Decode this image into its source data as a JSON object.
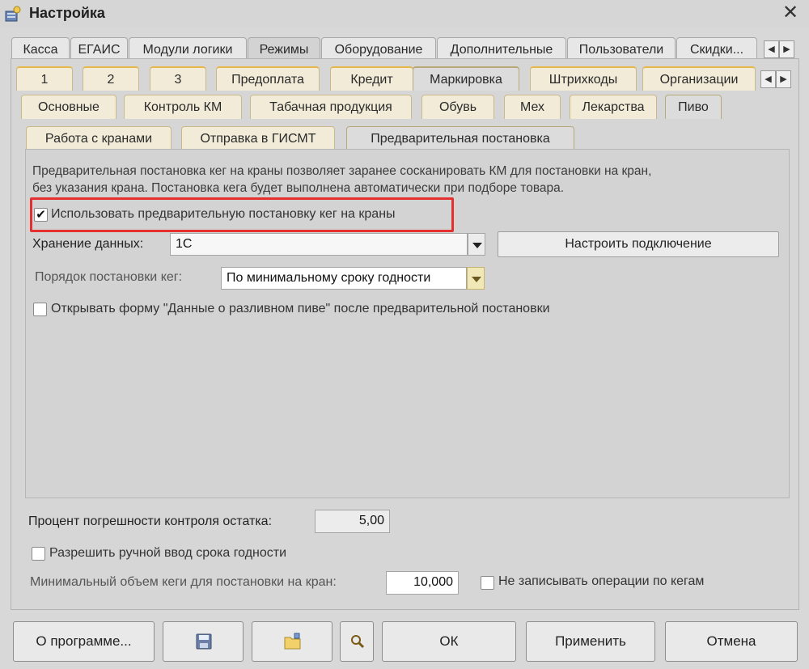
{
  "window": {
    "title": "Настройка"
  },
  "tabs_main": [
    "Касса",
    "ЕГАИС",
    "Модули логики",
    "Режимы",
    "Оборудование",
    "Дополнительные",
    "Пользователи",
    "Скидки..."
  ],
  "tabs_modes": [
    "1",
    "2",
    "3",
    "Предоплата",
    "Кредит",
    "Маркировка",
    "Штрихкоды",
    "Организации"
  ],
  "tabs_marking": [
    "Основные",
    "Контроль КМ",
    "Табачная продукция",
    "Обувь",
    "Мех",
    "Лекарства",
    "Пиво"
  ],
  "tabs_beer": [
    "Работа с кранами",
    "Отправка в ГИСМТ",
    "Предварительная постановка"
  ],
  "prereg": {
    "desc_line1": "Предварительная постановка кег на краны позволяет заранее сосканировать КМ для постановки на кран,",
    "desc_line2": "без указания крана. Постановка кега будет выполнена автоматически при подборе товара.",
    "use_prereg_label": "Использовать предварительную постановку кег на краны",
    "use_prereg_checked": true,
    "storage_label": "Хранение данных:",
    "storage_value": "1С",
    "setup_connection_label": "Настроить подключение",
    "order_label": "Порядок постановки кег:",
    "order_value": "По минимальному сроку годности",
    "open_form_label": "Открывать форму \"Данные о разливном пиве\" после предварительной постановки",
    "open_form_checked": false
  },
  "bottom": {
    "error_percent_label": "Процент погрешности контроля остатка:",
    "error_percent_value": "5,00",
    "manual_expiry_label": "Разрешить ручной ввод срока годности",
    "manual_expiry_checked": false,
    "min_volume_label": "Минимальный объем кеги для постановки на кран:",
    "min_volume_value": "10,000",
    "no_write_ops_label": "Не записывать операции по кегам",
    "no_write_ops_checked": false
  },
  "buttons": {
    "about": "О программе...",
    "ok": "ОК",
    "apply": "Применить",
    "cancel": "Отмена"
  },
  "icons": {
    "title": "settings-icon",
    "close": "close-icon",
    "save": "floppy-disk-icon",
    "load": "folder-open-icon",
    "search": "magnifier-icon"
  },
  "colors": {
    "highlight_border": "#e53030",
    "active_tab_accent": "#e6b84c"
  }
}
